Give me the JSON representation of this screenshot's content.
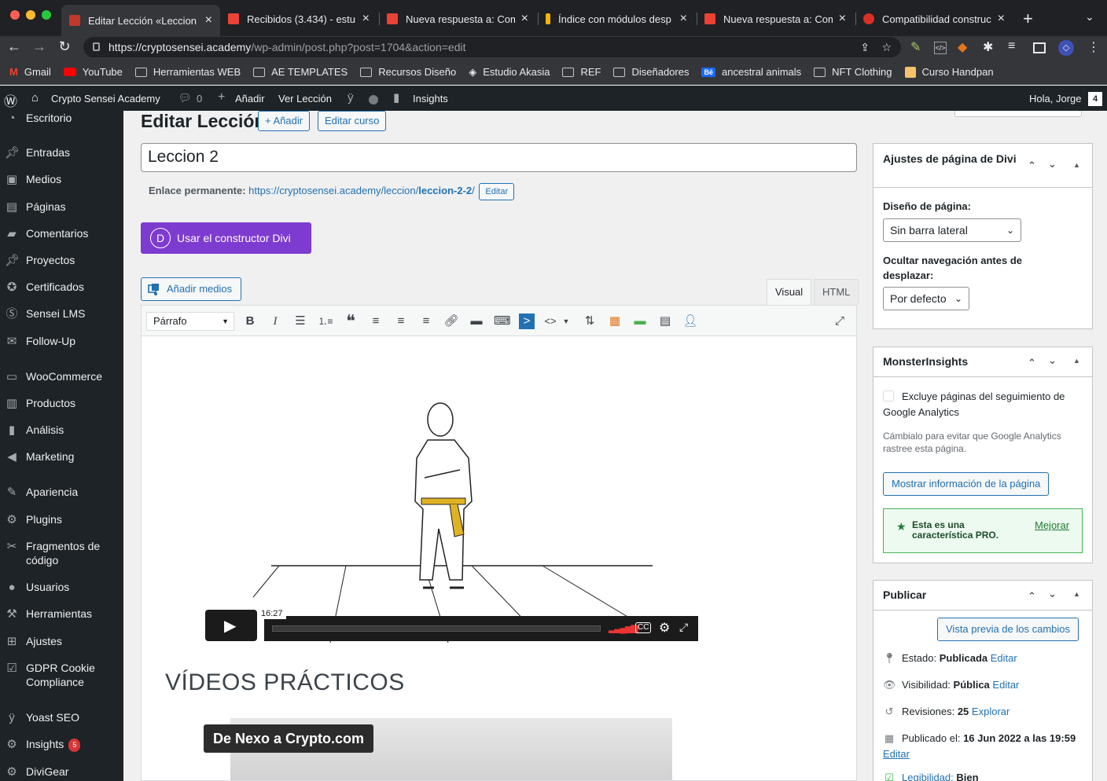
{
  "browser": {
    "tabs": [
      {
        "title": "Editar Lección «Leccion",
        "active": true,
        "favicon_color": "#c0392b"
      },
      {
        "title": "Recibidos (3.434) - estu",
        "favicon_color": "#ea4335"
      },
      {
        "title": "Nueva respuesta a: Com",
        "favicon_color": "#ea4335"
      },
      {
        "title": "Índice con módulos desp",
        "favicon_color": "#f4b400"
      },
      {
        "title": "Nueva respuesta a: Com",
        "favicon_color": "#ea4335"
      },
      {
        "title": "Compatibilidad construc",
        "favicon_color": "#d93025"
      }
    ],
    "url_host": "https://cryptosensei.academy",
    "url_path": "/wp-admin/post.php?post=1704&action=edit",
    "bookmarks": [
      "Gmail",
      "YouTube",
      "Herramientas WEB",
      "AE TEMPLATES",
      "Recursos Diseño",
      "Estudio Akasia",
      "REF",
      "Diseñadores",
      "ancestral animals",
      "NFT Clothing",
      "Curso Handpan"
    ]
  },
  "adminbar": {
    "site_name": "Crypto Sensei Academy",
    "comments_count": "0",
    "add_new": "Añadir",
    "view_item": "Ver Lección",
    "insights": "Insights",
    "greeting": "Hola, Jorge"
  },
  "sidebar": {
    "items": [
      {
        "label": "Escritorio",
        "icon": "dashboard-icon"
      },
      {
        "label": "Entradas",
        "icon": "pin-icon"
      },
      {
        "label": "Medios",
        "icon": "media-icon"
      },
      {
        "label": "Páginas",
        "icon": "page-icon"
      },
      {
        "label": "Comentarios",
        "icon": "comment-icon"
      },
      {
        "label": "Proyectos",
        "icon": "pin-icon"
      },
      {
        "label": "Certificados",
        "icon": "award-icon"
      },
      {
        "label": "Sensei LMS",
        "icon": "sensei-icon"
      },
      {
        "label": "Follow-Up",
        "icon": "email-icon"
      },
      {
        "label": "WooCommerce",
        "icon": "woo-icon"
      },
      {
        "label": "Productos",
        "icon": "archive-icon"
      },
      {
        "label": "Análisis",
        "icon": "chart-icon"
      },
      {
        "label": "Marketing",
        "icon": "megaphone-icon"
      },
      {
        "label": "Apariencia",
        "icon": "brush-icon"
      },
      {
        "label": "Plugins",
        "icon": "plugin-icon"
      },
      {
        "label": "Fragmentos de código",
        "icon": "scissors-icon"
      },
      {
        "label": "Usuarios",
        "icon": "user-icon"
      },
      {
        "label": "Herramientas",
        "icon": "wrench-icon"
      },
      {
        "label": "Ajustes",
        "icon": "settings-icon"
      },
      {
        "label": "GDPR Cookie Compliance",
        "icon": "check-icon"
      },
      {
        "label": "Yoast SEO",
        "icon": "yoast-icon"
      },
      {
        "label": "Insights",
        "icon": "insights-icon",
        "badge": "5"
      },
      {
        "label": "DiviGear",
        "icon": "gear-icon"
      }
    ]
  },
  "main": {
    "page_title": "Editar Lección",
    "add_new_button": "+ Añadir",
    "edit_course_button": "Editar curso",
    "post_title": "Leccion 2",
    "permalink_label": "Enlace permanente:",
    "permalink_base": "https://cryptosensei.academy/leccion/",
    "permalink_slug": "leccion-2-2",
    "permalink_suffix": "/",
    "permalink_edit": "Editar",
    "divi_button": "Usar el constructor Divi",
    "add_media": "Añadir medios",
    "tab_visual": "Visual",
    "tab_html": "HTML",
    "format_select": "Párrafo",
    "video_time": "16:27",
    "heading_text": "VÍDEOS PRÁCTICOS",
    "video2_title": "De Nexo a Crypto.com"
  },
  "divi_panel": {
    "title": "Ajustes de página de Divi",
    "layout_label": "Diseño de página:",
    "layout_value": "Sin barra lateral",
    "nav_label": "Ocultar navegación antes de desplazar:",
    "nav_value": "Por defecto"
  },
  "monster_panel": {
    "title": "MonsterInsights",
    "exclude_label": "Excluye páginas del seguimiento de Google Analytics",
    "help_text": "Cámbialo para evitar que Google Analytics rastree esta página.",
    "show_info_button": "Mostrar información de la página",
    "pro_text": "Esta es una característica PRO.",
    "upgrade_link": "Mejorar"
  },
  "publish_panel": {
    "title": "Publicar",
    "preview_button": "Vista previa de los cambios",
    "status_label": "Estado:",
    "status_value": "Publicada",
    "visibility_label": "Visibilidad:",
    "visibility_value": "Pública",
    "revisions_label": "Revisiones:",
    "revisions_value": "25",
    "revisions_link": "Explorar",
    "published_label": "Publicado el:",
    "published_value": "16 Jun 2022 a las 19:59",
    "edit_link": "Editar",
    "readability_label": "Legibilidad:",
    "readability_value": "Bien"
  },
  "colors": {
    "wp_blue": "#2271b1",
    "divi_purple": "#7e3bd0",
    "admin_dark": "#1d2327",
    "badge_red": "#d63638"
  }
}
